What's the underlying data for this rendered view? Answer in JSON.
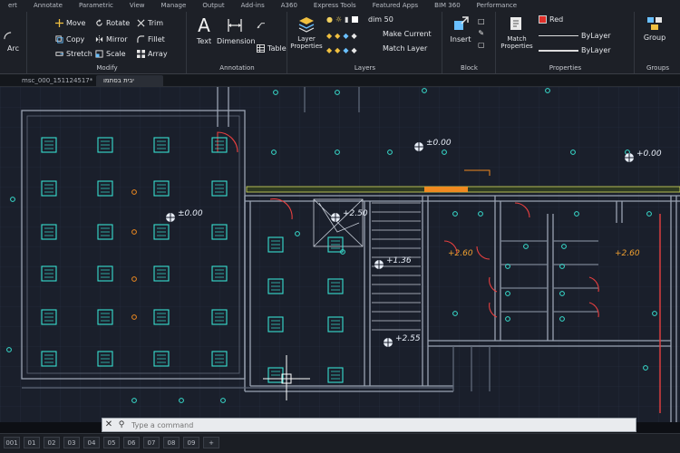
{
  "ribbon": {
    "tabs": [
      "ert",
      "Annotate",
      "Parametric",
      "View",
      "Manage",
      "Output",
      "Add-ins",
      "A360",
      "Express Tools",
      "Featured Apps",
      "BIM 360",
      "Performance"
    ],
    "modify": {
      "label": "Modify",
      "move": "Move",
      "rotate": "Rotate",
      "trim": "Trim",
      "copy": "Copy",
      "mirror": "Mirror",
      "fillet": "Fillet",
      "stretch": "Stretch",
      "scale": "Scale",
      "array": "Array",
      "arc": "Arc"
    },
    "annotation": {
      "label": "Annotation",
      "text": "Text",
      "dimension": "Dimension",
      "table": "Table"
    },
    "layers": {
      "label": "Layers",
      "layer_properties": "Layer Properties",
      "current_layer": "dim 50",
      "make_current": "Make Current",
      "match_layer": "Match Layer"
    },
    "block": {
      "label": "Block",
      "insert": "Insert"
    },
    "properties": {
      "label": "Properties",
      "match_properties": "Match Properties",
      "color": "Red",
      "color_hex": "#e0302a",
      "linetype": "ByLayer",
      "lineweight": "ByLayer"
    },
    "groups": {
      "label": "Groups",
      "group": "Group"
    }
  },
  "file_tabs": [
    "msc_000_151124517*",
    "יבית בסתמו"
  ],
  "canvas": {
    "background": "#1a1f2b",
    "level_marks": [
      "±0.00",
      "±0.00",
      "+0.00",
      "+2.50",
      "+1.36",
      "+2.55",
      "+2.60",
      "+2.60"
    ]
  },
  "command_line": {
    "placeholder": "Type a command"
  },
  "layout_tabs": [
    "001",
    "01",
    "02",
    "03",
    "04",
    "05",
    "06",
    "07",
    "08",
    "09",
    "+"
  ]
}
